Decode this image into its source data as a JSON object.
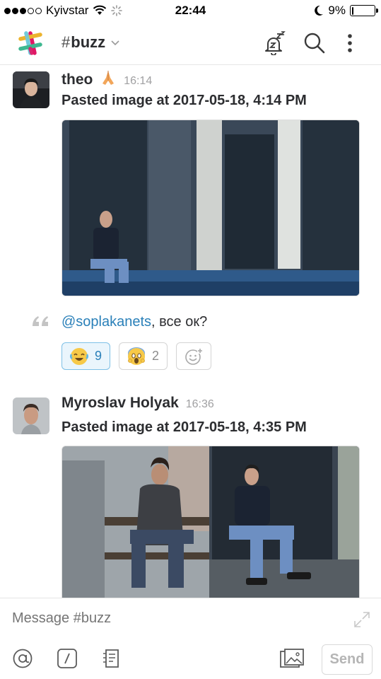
{
  "status_bar": {
    "carrier": "Kyivstar",
    "time": "22:44",
    "battery": "9%",
    "battery_level": 0.09,
    "signal_bars": 3
  },
  "header": {
    "channel_hash": "#",
    "channel_name": "buzz",
    "icons": [
      "slack-logo",
      "snooze-bell-icon",
      "search-icon",
      "more-vertical-icon"
    ]
  },
  "messages": [
    {
      "sender": "theo",
      "sender_emoji": "folded-hands",
      "time": "16:14",
      "text": "Pasted image at 2017-05-18, 4:14 PM",
      "quote": {
        "mention": "@soplakanets",
        "rest": ", все ок?"
      },
      "reactions": [
        {
          "emoji": "joy",
          "count": "9",
          "active": true
        },
        {
          "emoji": "scream",
          "count": "2",
          "active": false
        },
        {
          "emoji": "add-reaction",
          "count": "",
          "active": false
        }
      ]
    },
    {
      "sender": "Myroslav Holyak",
      "time": "16:36",
      "text": "Pasted image at 2017-05-18, 4:35 PM"
    }
  ],
  "composer": {
    "placeholder": "Message #buzz",
    "send_label": "Send",
    "tools": [
      "at-icon",
      "slash-command-icon",
      "snippet-icon",
      "photo-icon"
    ]
  }
}
